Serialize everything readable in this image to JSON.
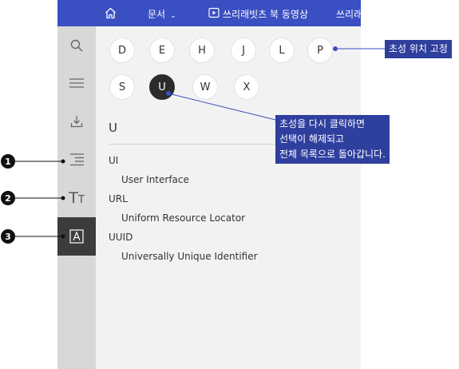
{
  "topbar": {
    "home_icon": "home-icon",
    "docs_label": "문서",
    "docs_chevron": "⌄",
    "video_icon": "play-video-icon",
    "video_label": "쓰리래빗츠 북 동영상",
    "more_label": "쓰리래"
  },
  "sidebar": {
    "tools": [
      {
        "icon": "search-icon"
      },
      {
        "icon": "menu-icon"
      },
      {
        "icon": "download-icon"
      },
      {
        "icon": "index-list-icon"
      },
      {
        "icon": "text-size-icon",
        "label": "TT"
      },
      {
        "icon": "alphabet-a-icon",
        "label": "A",
        "active": true
      }
    ]
  },
  "initials": {
    "row1": [
      "D",
      "E",
      "H",
      "J",
      "L",
      "P"
    ],
    "row2": [
      "S",
      "U",
      "W",
      "X"
    ],
    "selected": "U"
  },
  "section": {
    "heading": "U",
    "entries": [
      {
        "term": "UI",
        "desc": "User Interface"
      },
      {
        "term": "URL",
        "desc": "Uniform Resource Locator"
      },
      {
        "term": "UUID",
        "desc": "Universally Unique Identifier"
      }
    ]
  },
  "annotations": {
    "callout_fixed": "초성 위치 고정",
    "callout_toggle": [
      "초성을 다시 클릭하면",
      "선택이 해제되고",
      "전체 목록으로 돌아갑니다."
    ],
    "markers": [
      "1",
      "2",
      "3"
    ]
  },
  "colors": {
    "topbar": "#3a4fc1",
    "callout": "#2f3f9e",
    "sidebar": "#d8d8d8",
    "panel": "#f2f2f2",
    "active_tool": "#3c3c3c"
  }
}
